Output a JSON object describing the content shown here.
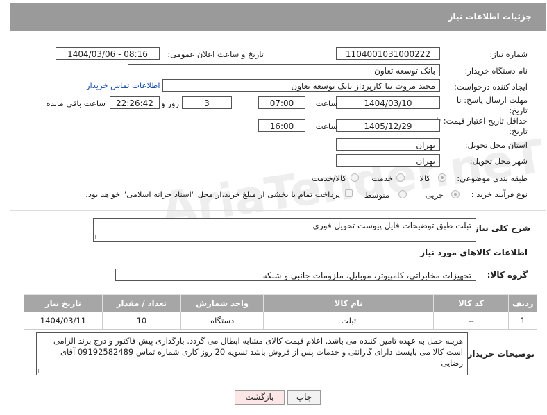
{
  "header": {
    "title": "جزئیات اطلاعات نیاز"
  },
  "fields": {
    "need_number_label": "شماره نیاز:",
    "need_number": "1104001031000222",
    "announce_label": "تاریخ و ساعت اعلان عمومی:",
    "announce_value": "1404/03/06 - 08:16",
    "buyer_org_label": "نام دستگاه خریدار:",
    "buyer_org": "بانک توسعه تعاون",
    "requester_label": "ایجاد کننده درخواست:",
    "requester": "مجید مروت نیا کارپرداز بانک توسعه تعاون",
    "contact_link": "اطلاعات تماس خریدار",
    "reply_deadline_label": "مهلت ارسال پاسخ: تا تاریخ:",
    "reply_date": "1404/03/10",
    "time_label": "ساعت",
    "reply_time": "07:00",
    "days_value": "3",
    "days_label": "روز و",
    "remaining_time": "22:26:42",
    "remaining_label": "ساعت باقی مانده",
    "price_validity_label": "حداقل تاریخ اعتبار قیمت: تا تاریخ:",
    "price_date": "1405/12/29",
    "price_time_label": "ساعت",
    "price_time": "16:00",
    "province_label": "استان محل تحویل:",
    "province": "تهران",
    "city_label": "شهر محل تحویل:",
    "city": "تهران",
    "category_label": "طبقه بندی موضوعی:",
    "category_options": [
      "کالا",
      "خدمت",
      "کالا/خدمت"
    ],
    "process_label": "نوع فرآیند خرید :",
    "process_options": [
      "جزیی",
      "متوسط"
    ],
    "payment_note": "پرداخت تمام یا بخشی از مبلغ خرید،از محل \"اسناد خزانه اسلامی\" خواهد بود."
  },
  "description": {
    "label": "شرح کلی نیاز:",
    "value": "تبلت طبق توضیحات فایل پیوست تحویل فوری"
  },
  "goods_section": {
    "title": "اطلاعات کالاهای مورد نیاز",
    "group_label": "گروه کالا:",
    "group_value": "تجهیزات مخابراتی، کامپیوتر، موبایل، ملزومات جانبی و شبکه"
  },
  "table": {
    "headers": [
      "ردیف",
      "کد کالا",
      "نام کالا",
      "واحد شمارش",
      "تعداد / مقدار",
      "تاریخ نیاز"
    ],
    "rows": [
      [
        "1",
        "--",
        "تبلت",
        "دستگاه",
        "10",
        "1404/03/11"
      ]
    ]
  },
  "buyer_notes": {
    "label": "توضیحات خریدار:",
    "value": "هزینه حمل به عهده تامین کننده می باشد. اعلام قیمت کالای مشابه ابطال می گردد. بارگذاری پیش فاکتور و درج برند الزامی است کالا می بایست دارای گارانتی و خدمات پس از فروش باشد تسویه 20 روز کاری شماره تماس 09192582489 آقای رضایی"
  },
  "buttons": {
    "print": "چاپ",
    "back": "بازگشت"
  },
  "watermark": "AriaTender.neT",
  "colors": {
    "header_bg": "#9a9a9a",
    "table_header_bg": "#a6a6a6",
    "link": "#1a4fb0",
    "back_button_bg": "#fde6e6"
  }
}
